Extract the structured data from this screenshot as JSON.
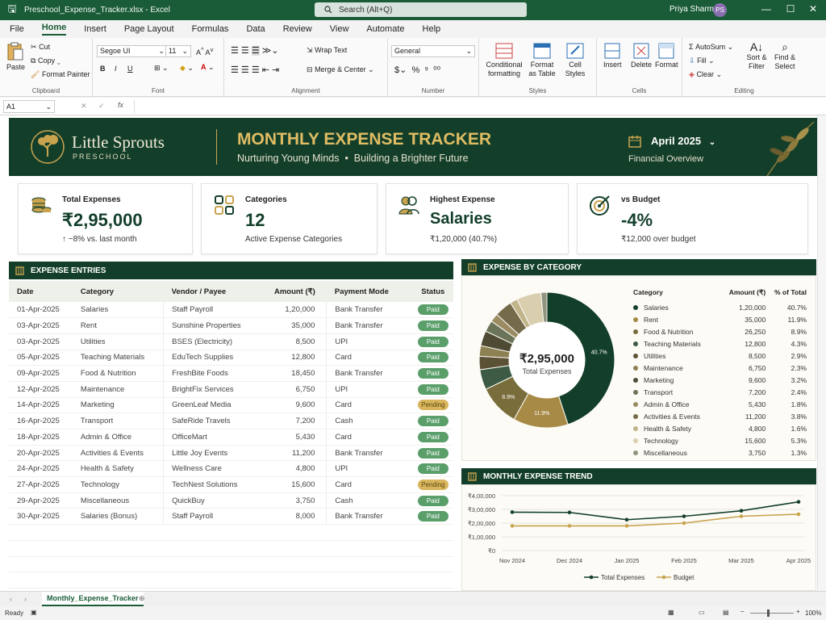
{
  "window": {
    "file_name": "Preschool_Expense_Tracker.xlsx - Excel",
    "search_placeholder": "Search (Alt+Q)",
    "user_name": "Priya Sharma",
    "user_initials": "PS"
  },
  "menu": [
    "File",
    "Home",
    "Insert",
    "Page Layout",
    "Formulas",
    "Data",
    "Review",
    "View",
    "Automate",
    "Help"
  ],
  "ribbon": {
    "clipboard": {
      "paste": "Paste",
      "cut": "Cut",
      "copy": "Copy",
      "format_painter": "Format Painter",
      "label": "Clipboard"
    },
    "font": {
      "family": "Segoe UI",
      "size": "11",
      "label": "Font",
      "bold": "B",
      "italic": "I",
      "underline": "U"
    },
    "alignment": {
      "wrap": "Wrap Text",
      "merge": "Merge & Center",
      "label": "Alignment"
    },
    "number": {
      "format": "General",
      "label": "Number"
    },
    "styles": {
      "conditional": "Conditional formatting",
      "format_table": "Format as Table",
      "cell_styles": "Cell Styles",
      "label": "Styles"
    },
    "cells": {
      "insert": "Insert",
      "delete": "Delete",
      "format": "Format",
      "label": "Cells"
    },
    "editing": {
      "autosum": "AutoSum",
      "fill": "Fill",
      "clear": "Clear",
      "sort": "Sort & Filter",
      "find": "Find & Select",
      "label": "Editing"
    }
  },
  "formula_bar": {
    "cell_ref": "A1",
    "fx": "fx",
    "value": ""
  },
  "banner": {
    "brand_top": "Little Sprouts",
    "brand_bottom": "PRESCHOOL",
    "title": "MONTHLY EXPENSE TRACKER",
    "tagline_left": "Nurturing Young Minds",
    "tagline_sep": "•",
    "tagline_right": "Building a Brighter Future",
    "period": "April 2025",
    "period_sub": "Financial Overview"
  },
  "cards": [
    {
      "title": "Total Expenses",
      "value": "₹2,95,000",
      "sub": "↑ ~8% vs. last month",
      "icon": "coins-icon"
    },
    {
      "title": "Categories",
      "value": "12",
      "sub": "Active Expense Categories",
      "icon": "grid-icon"
    },
    {
      "title": "Highest Expense",
      "value": "Salaries",
      "sub": "₹1,20,000 (40.7%)",
      "icon": "people-icon"
    },
    {
      "title": "vs Budget",
      "value": "-4%",
      "sub": "₹12,000 over budget",
      "icon": "target-icon"
    }
  ],
  "entries": {
    "title": "EXPENSE ENTRIES",
    "headers": [
      "Date",
      "Category",
      "Vendor / Payee",
      "Amount (₹)",
      "Payment Mode",
      "Status"
    ],
    "rows": [
      [
        "01-Apr-2025",
        "Salaries",
        "Staff Payroll",
        "1,20,000",
        "Bank Transfer",
        "Paid"
      ],
      [
        "03-Apr-2025",
        "Rent",
        "Sunshine Properties",
        "35,000",
        "Bank Transfer",
        "Paid"
      ],
      [
        "03-Apr-2025",
        "Utilities",
        "BSES (Electricity)",
        "8,500",
        "UPI",
        "Paid"
      ],
      [
        "05-Apr-2025",
        "Teaching Materials",
        "EduTech Supplies",
        "12,800",
        "Card",
        "Paid"
      ],
      [
        "09-Apr-2025",
        "Food & Nutrition",
        "FreshBite Foods",
        "18,450",
        "Bank Transfer",
        "Paid"
      ],
      [
        "12-Apr-2025",
        "Maintenance",
        "BrightFix Services",
        "6,750",
        "UPI",
        "Paid"
      ],
      [
        "14-Apr-2025",
        "Marketing",
        "GreenLeaf Media",
        "9,600",
        "Card",
        "Pending"
      ],
      [
        "16-Apr-2025",
        "Transport",
        "SafeRide Travels",
        "7,200",
        "Cash",
        "Paid"
      ],
      [
        "18-Apr-2025",
        "Admin & Office",
        "OfficeMart",
        "5,430",
        "Card",
        "Paid"
      ],
      [
        "20-Apr-2025",
        "Activities & Events",
        "Little Joy Events",
        "11,200",
        "Bank Transfer",
        "Paid"
      ],
      [
        "24-Apr-2025",
        "Health & Safety",
        "Wellness Care",
        "4,800",
        "UPI",
        "Paid"
      ],
      [
        "27-Apr-2025",
        "Technology",
        "TechNest Solutions",
        "15,600",
        "Card",
        "Pending"
      ],
      [
        "29-Apr-2025",
        "Miscellaneous",
        "QuickBuy",
        "3,750",
        "Cash",
        "Paid"
      ],
      [
        "30-Apr-2025",
        "Salaries (Bonus)",
        "Staff Payroll",
        "8,000",
        "Bank Transfer",
        "Paid"
      ]
    ]
  },
  "category_panel": {
    "title": "EXPENSE BY CATEGORY",
    "center_value": "₹2,95,000",
    "center_label": "Total Expenses",
    "headers": [
      "Category",
      "Amount (₹)",
      "% of Total"
    ],
    "rows": [
      {
        "name": "Salaries",
        "amount": "1,20,000",
        "pct": "40.7%",
        "color": "#133f2a"
      },
      {
        "name": "Rent",
        "amount": "35,000",
        "pct": "11.9%",
        "color": "#a88a47"
      },
      {
        "name": "Food & Nutrition",
        "amount": "26,250",
        "pct": "8.9%",
        "color": "#7a6d3c"
      },
      {
        "name": "Teaching Materials",
        "amount": "12,800",
        "pct": "4.3%",
        "color": "#3c5a44"
      },
      {
        "name": "Utilities",
        "amount": "8,500",
        "pct": "2.9%",
        "color": "#5b5135"
      },
      {
        "name": "Maintenance",
        "amount": "6,750",
        "pct": "2.3%",
        "color": "#8d8052"
      },
      {
        "name": "Marketing",
        "amount": "9,600",
        "pct": "3.2%",
        "color": "#4e4a33"
      },
      {
        "name": "Transport",
        "amount": "7,200",
        "pct": "2.4%",
        "color": "#6b7458"
      },
      {
        "name": "Admin & Office",
        "amount": "5,430",
        "pct": "1.8%",
        "color": "#9b8b62"
      },
      {
        "name": "Activities & Events",
        "amount": "11,200",
        "pct": "3.8%",
        "color": "#756a4a"
      },
      {
        "name": "Health & Safety",
        "amount": "4,800",
        "pct": "1.6%",
        "color": "#c2b48a"
      },
      {
        "name": "Technology",
        "amount": "15,600",
        "pct": "5.3%",
        "color": "#d9cfae"
      },
      {
        "name": "Miscellaneous",
        "amount": "3,750",
        "pct": "1.3%",
        "color": "#8f9481"
      }
    ],
    "slice_labels": {
      "first": "40.7%",
      "second": "11.9%",
      "third": "8.9%"
    }
  },
  "chart_data": {
    "type": "line",
    "title": "MONTHLY EXPENSE TREND",
    "categories": [
      "Nov 2024",
      "Dec 2024",
      "Jan 2025",
      "Feb 2025",
      "Mar 2025",
      "Apr 2025"
    ],
    "y_ticks": [
      "₹0",
      "₹1,00,000",
      "₹2,00,000",
      "₹3,00,000",
      "₹4,00,000"
    ],
    "ylim": [
      0,
      400000
    ],
    "series": [
      {
        "name": "Total Expenses",
        "values": [
          280000,
          278000,
          225000,
          250000,
          290000,
          355000
        ],
        "color": "#133f2a"
      },
      {
        "name": "Budget",
        "values": [
          180000,
          180000,
          180000,
          200000,
          250000,
          265000
        ],
        "color": "#c9a34e"
      }
    ],
    "legend_position": "bottom"
  },
  "tabs": {
    "sheet": "Monthly_Expense_Tracker"
  },
  "status": {
    "ready": "Ready",
    "zoom": "100%"
  }
}
